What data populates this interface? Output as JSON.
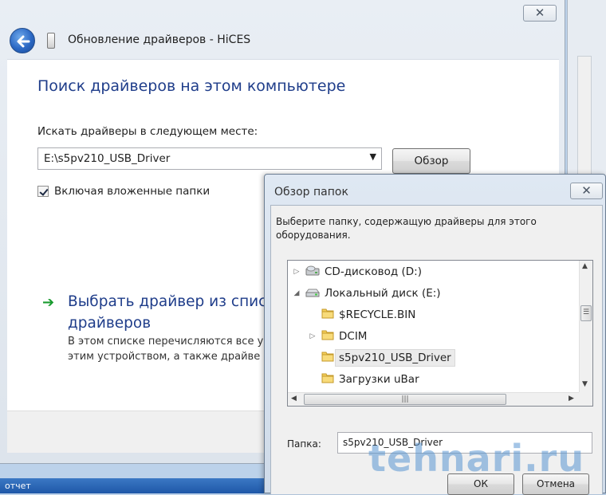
{
  "wizard": {
    "title": "Обновление драйверов - HiCES",
    "close_glyph": "✕",
    "heading": "Поиск драйверов на этом компьютере",
    "search_label": "Искать драйверы в следующем месте:",
    "path_value": "E:\\s5pv210_USB_Driver",
    "browse_label": "Обзор",
    "include_subfolders_label": "Включая вложенные папки",
    "include_subfolders_checked": true,
    "pick_title": "Выбрать драйвер из списка драйверов",
    "pick_desc": "В этом списке перечисляются все у с этим устройством, а также драйве"
  },
  "background": {
    "bottom_text": "отчет"
  },
  "browse_dialog": {
    "title": "Обзор папок",
    "close_glyph": "✕",
    "description": "Выберите папку, содержащую драйверы для этого оборудования.",
    "tree": [
      {
        "label": "CD-дисковод (D:)",
        "icon": "cd-drive-icon",
        "expander": "▷",
        "level": 0
      },
      {
        "label": "Локальный диск (E:)",
        "icon": "local-disk-icon",
        "expander": "◢",
        "level": 0
      },
      {
        "label": "$RECYCLE.BIN",
        "icon": "folder-icon",
        "expander": "",
        "level": 1
      },
      {
        "label": "DCIM",
        "icon": "folder-icon",
        "expander": "▷",
        "level": 1
      },
      {
        "label": "s5pv210_USB_Driver",
        "icon": "folder-icon",
        "expander": "",
        "level": 1,
        "selected": true
      },
      {
        "label": "Загрузки uBar",
        "icon": "folder-icon",
        "expander": "",
        "level": 1
      }
    ],
    "folder_label": "Папка:",
    "folder_value": "s5pv210_USB_Driver",
    "ok_label": "ОК",
    "cancel_label": "Отмена"
  },
  "watermark": "tehnari.ru",
  "colors": {
    "heading_blue": "#1f3d8a",
    "link_green": "#1a9b2f",
    "dialog_frame": "#cfdbe9"
  }
}
